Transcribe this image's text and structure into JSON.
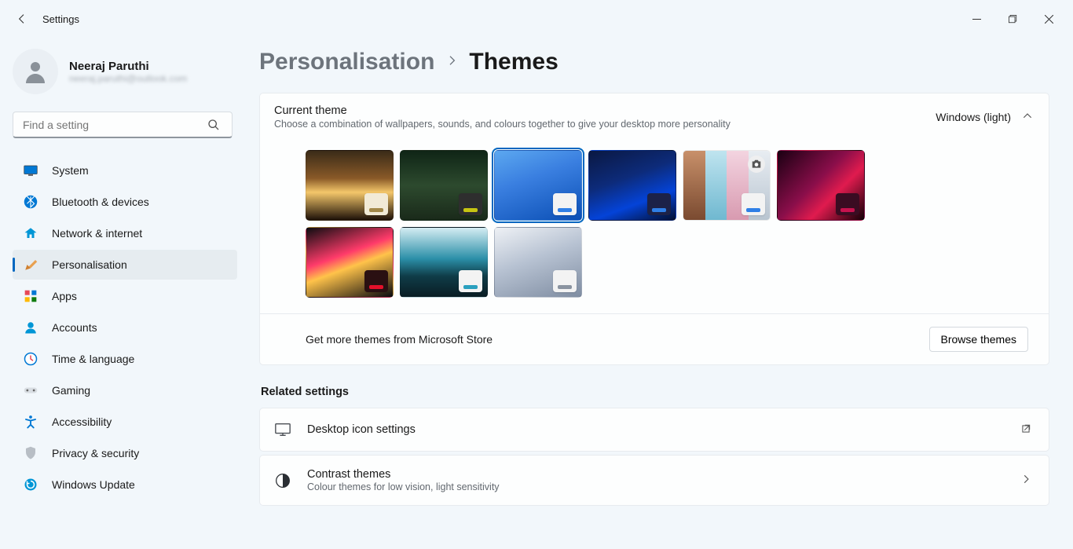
{
  "app_title": "Settings",
  "user": {
    "name": "Neeraj Paruthi",
    "email": "neeraj.paruthi@outlook.com"
  },
  "search": {
    "placeholder": "Find a setting"
  },
  "nav": [
    {
      "key": "system",
      "label": "System"
    },
    {
      "key": "bluetooth",
      "label": "Bluetooth & devices"
    },
    {
      "key": "network",
      "label": "Network & internet"
    },
    {
      "key": "personalisation",
      "label": "Personalisation",
      "selected": true
    },
    {
      "key": "apps",
      "label": "Apps"
    },
    {
      "key": "accounts",
      "label": "Accounts"
    },
    {
      "key": "time",
      "label": "Time & language"
    },
    {
      "key": "gaming",
      "label": "Gaming"
    },
    {
      "key": "accessibility",
      "label": "Accessibility"
    },
    {
      "key": "privacy",
      "label": "Privacy & security"
    },
    {
      "key": "update",
      "label": "Windows Update"
    }
  ],
  "breadcrumb": {
    "parent": "Personalisation",
    "current": "Themes"
  },
  "current_theme": {
    "title": "Current theme",
    "subtitle": "Choose a combination of wallpapers, sounds, and colours together to give your desktop more personality",
    "value": "Windows (light)"
  },
  "themes": [
    {
      "accent": "#a38848",
      "chip_bg": "#f2ead6"
    },
    {
      "accent": "#c6c412",
      "chip_bg": "#2e2e2e"
    },
    {
      "accent": "#2f7fe6",
      "chip_bg": "#f3f3f3",
      "selected": true
    },
    {
      "accent": "#2f7fe6",
      "chip_bg": "#1c2248"
    },
    {
      "accent": "#2f7fe6",
      "chip_bg": "#f3f3f3",
      "camera": true
    },
    {
      "accent": "#c6124e",
      "chip_bg": "#3a0c22"
    },
    {
      "accent": "#e3102a",
      "chip_bg": "#2a1012"
    },
    {
      "accent": "#2aa0bf",
      "chip_bg": "#f3f3f3"
    },
    {
      "accent": "#8a93a0",
      "chip_bg": "#f3f3f3"
    }
  ],
  "store": {
    "label": "Get more themes from Microsoft Store",
    "button": "Browse themes"
  },
  "related": {
    "title": "Related settings",
    "items": [
      {
        "key": "desktop-icons",
        "title": "Desktop icon settings",
        "subtitle": "",
        "external": true
      },
      {
        "key": "contrast",
        "title": "Contrast themes",
        "subtitle": "Colour themes for low vision, light sensitivity",
        "external": false
      }
    ]
  }
}
